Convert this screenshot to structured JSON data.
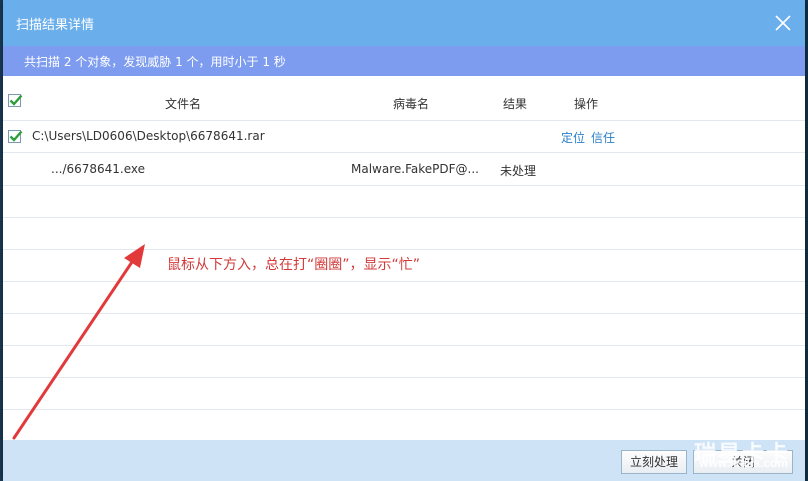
{
  "dialog": {
    "title": "扫描结果详情",
    "summary": "共扫描 2 个对象，发现威胁 1 个，用时小于 1 秒"
  },
  "table": {
    "columns": {
      "filename": "文件名",
      "virus": "病毒名",
      "result": "结果",
      "action": "操作"
    },
    "rows": [
      {
        "path": "C:\\Users\\LD0606\\Desktop\\6678641.rar",
        "checked": true,
        "locate": "定位",
        "trust": "信任"
      },
      {
        "path": ".../6678641.exe",
        "virus": "Malware.FakePDF@...",
        "result": "未处理"
      }
    ]
  },
  "footer": {
    "process_label": "立刻处理",
    "close_label": "关闭"
  },
  "annotation": {
    "text": "鼠标从下方入，总在打“圈圈”，显示“忙”",
    "color": "#d23a3a"
  },
  "watermark": {
    "brand": "瑞星卡卡",
    "url": "www.ikaka.com"
  },
  "colors": {
    "titlebar": "#6aaeeb",
    "summary_bar": "#7d9cf0",
    "link": "#2a7fc8",
    "check": "#2e9e3a",
    "footer": "#cfe3f7"
  }
}
